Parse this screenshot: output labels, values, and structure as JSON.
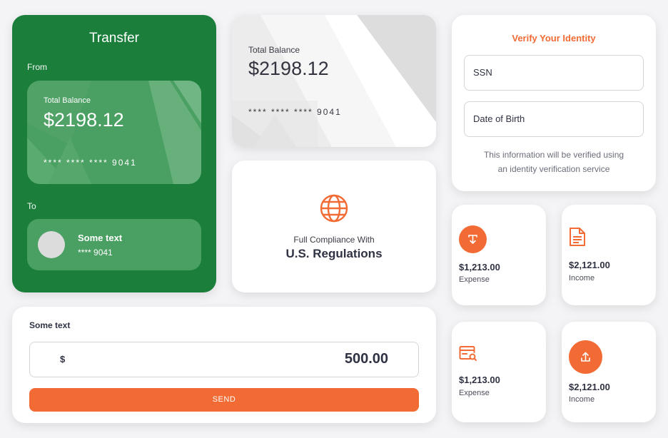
{
  "transfer": {
    "title": "Transfer",
    "from_label": "From",
    "to_label": "To",
    "card": {
      "balance_label": "Total Balance",
      "balance": "$2198.12",
      "number": "**** **** **** 9041"
    },
    "recipient": {
      "name": "Some text",
      "account": "**** 9041"
    }
  },
  "balance_card": {
    "balance_label": "Total Balance",
    "balance": "$2198.12",
    "number": "**** **** **** 9041"
  },
  "compliance": {
    "icon": "globe-icon",
    "subtitle": "Full Compliance With",
    "title": "U.S. Regulations"
  },
  "verify": {
    "title": "Verify Your Identity",
    "ssn_placeholder": "SSN",
    "dob_placeholder": "Date of Birth",
    "note_line1": "This information will be verified using",
    "note_line2": "an identity verification service"
  },
  "stats": [
    {
      "icon": "download-icon",
      "value": "$1,213.00",
      "caption": "Expense"
    },
    {
      "icon": "document-icon",
      "value": "$2,121.00",
      "caption": "Income"
    },
    {
      "icon": "card-search-icon",
      "value": "$1,213.00",
      "caption": "Expense"
    },
    {
      "icon": "upload-icon",
      "value": "$2,121.00",
      "caption": "Income"
    }
  ],
  "send": {
    "label": "Some text",
    "currency": "$",
    "amount": "500.00",
    "button": "SEND"
  },
  "colors": {
    "green": "#1b7f3b",
    "accent": "#f26b34"
  }
}
